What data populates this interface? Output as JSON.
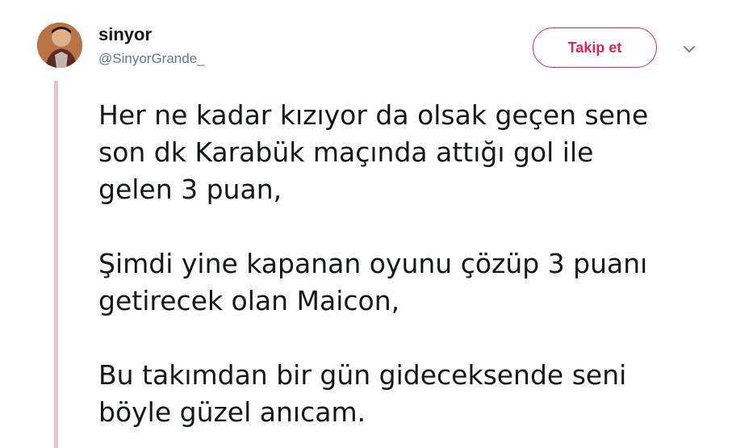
{
  "user": {
    "name": "sinyor",
    "handle": "@SinyorGrande_"
  },
  "follow_button": {
    "label": "Takip et"
  },
  "tweet": {
    "paragraph1": [
      "Her ne kadar kızıyor da olsak geçen sene",
      "son dk Karabük maçında attığı gol ile",
      "gelen 3 puan,"
    ],
    "paragraph2": [
      "Şimdi yine kapanan oyunu çözüp 3 puanı",
      "getirecek olan Maicon,"
    ],
    "paragraph3": [
      "Bu takımdan bir gün gideceksende seni",
      "böyle güzel anıcam."
    ]
  },
  "icons": {
    "menu": "chevron-down-icon",
    "avatar": "profile-photo"
  },
  "colors": {
    "accent": "#e0245e",
    "text": "#14171a",
    "muted": "#657786",
    "thread_line": "#e7c3c9"
  }
}
